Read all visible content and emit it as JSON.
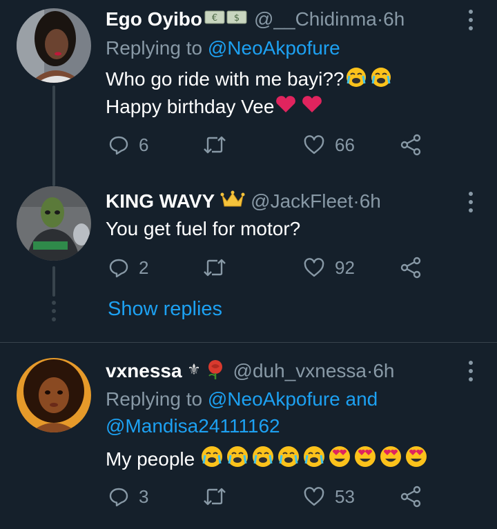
{
  "tweets": [
    {
      "name": "Ego Oyibo",
      "name_badge": "money-banknote-emoji",
      "handle": "@__Chidinma",
      "time": "6h",
      "replying_prefix": "Replying to ",
      "replying_to": "@NeoAkpofure",
      "replying_suffix": "",
      "lines": [
        "Who go ride with me bayi??",
        "Happy birthday Vee"
      ],
      "replies": "6",
      "retweets": "",
      "likes": "66"
    },
    {
      "name": "KING WAVY",
      "name_badge": "crown-emoji",
      "handle": "@JackFleet",
      "time": "6h",
      "lines": [
        "You get fuel for motor?"
      ],
      "replies": "2",
      "retweets": "",
      "likes": "92",
      "show_replies": "Show replies"
    },
    {
      "name": "vxnessa",
      "name_badge": "fleur-de-lis-rose-emoji",
      "handle": "@duh_vxnessa",
      "time": "6h",
      "replying_prefix": "Replying to ",
      "replying_to": "@NeoAkpofure",
      "replying_and": " and",
      "replying_to_2": "@Mandisa24111162",
      "lines": [
        "My people "
      ],
      "replies": "3",
      "retweets": "",
      "likes": "53"
    }
  ],
  "time_separator": " · ",
  "colors": {
    "background": "#15202b",
    "secondary_text": "#8899a6",
    "link": "#1da1f2",
    "divider": "#38444d",
    "heart_emoji": "#e0245e"
  },
  "icons": {
    "reply": "reply-icon",
    "retweet": "retweet-icon",
    "like": "like-icon",
    "share": "share-icon",
    "more": "more-vertical-icon"
  }
}
